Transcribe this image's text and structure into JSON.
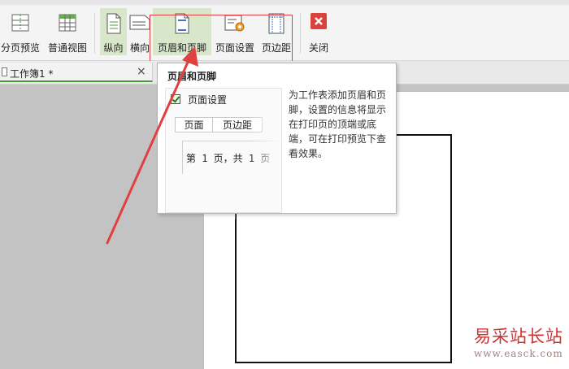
{
  "ribbon": {
    "buttons": [
      {
        "key": "page-break-preview",
        "label": "分页预览",
        "icon": "page-break-preview-icon"
      },
      {
        "key": "normal-view",
        "label": "普通视图",
        "icon": "grid-view-icon"
      },
      {
        "key": "portrait",
        "label": "纵向",
        "icon": "portrait-page-icon",
        "active": true
      },
      {
        "key": "landscape",
        "label": "横向",
        "icon": "landscape-page-icon"
      },
      {
        "key": "header-footer",
        "label": "页眉和页脚",
        "icon": "header-footer-icon",
        "active": true
      },
      {
        "key": "page-setup",
        "label": "页面设置",
        "icon": "page-setup-gear-icon"
      },
      {
        "key": "margins",
        "label": "页边距",
        "icon": "margins-icon"
      },
      {
        "key": "close",
        "label": "关闭",
        "icon": "close-red-icon"
      }
    ]
  },
  "workbook_tab": {
    "name": "工作簿1 *",
    "close": "×"
  },
  "tooltip": {
    "title": "页眉和页脚",
    "description": "为工作表添加页眉和页脚，设置的信息将显示在打印页的顶端或底端，可在打印预览下查看效果。",
    "preview": {
      "dialog_title": "页面设置",
      "tabs": [
        "页面",
        "页边距"
      ],
      "sample_text": "第 1 页，共 1 页"
    }
  },
  "watermark": {
    "cn": "易采站长站",
    "url": "www.easck.com"
  },
  "colors": {
    "accent": "#4a9a3c",
    "highlight": "#e04040",
    "close_red": "#d9433d"
  }
}
